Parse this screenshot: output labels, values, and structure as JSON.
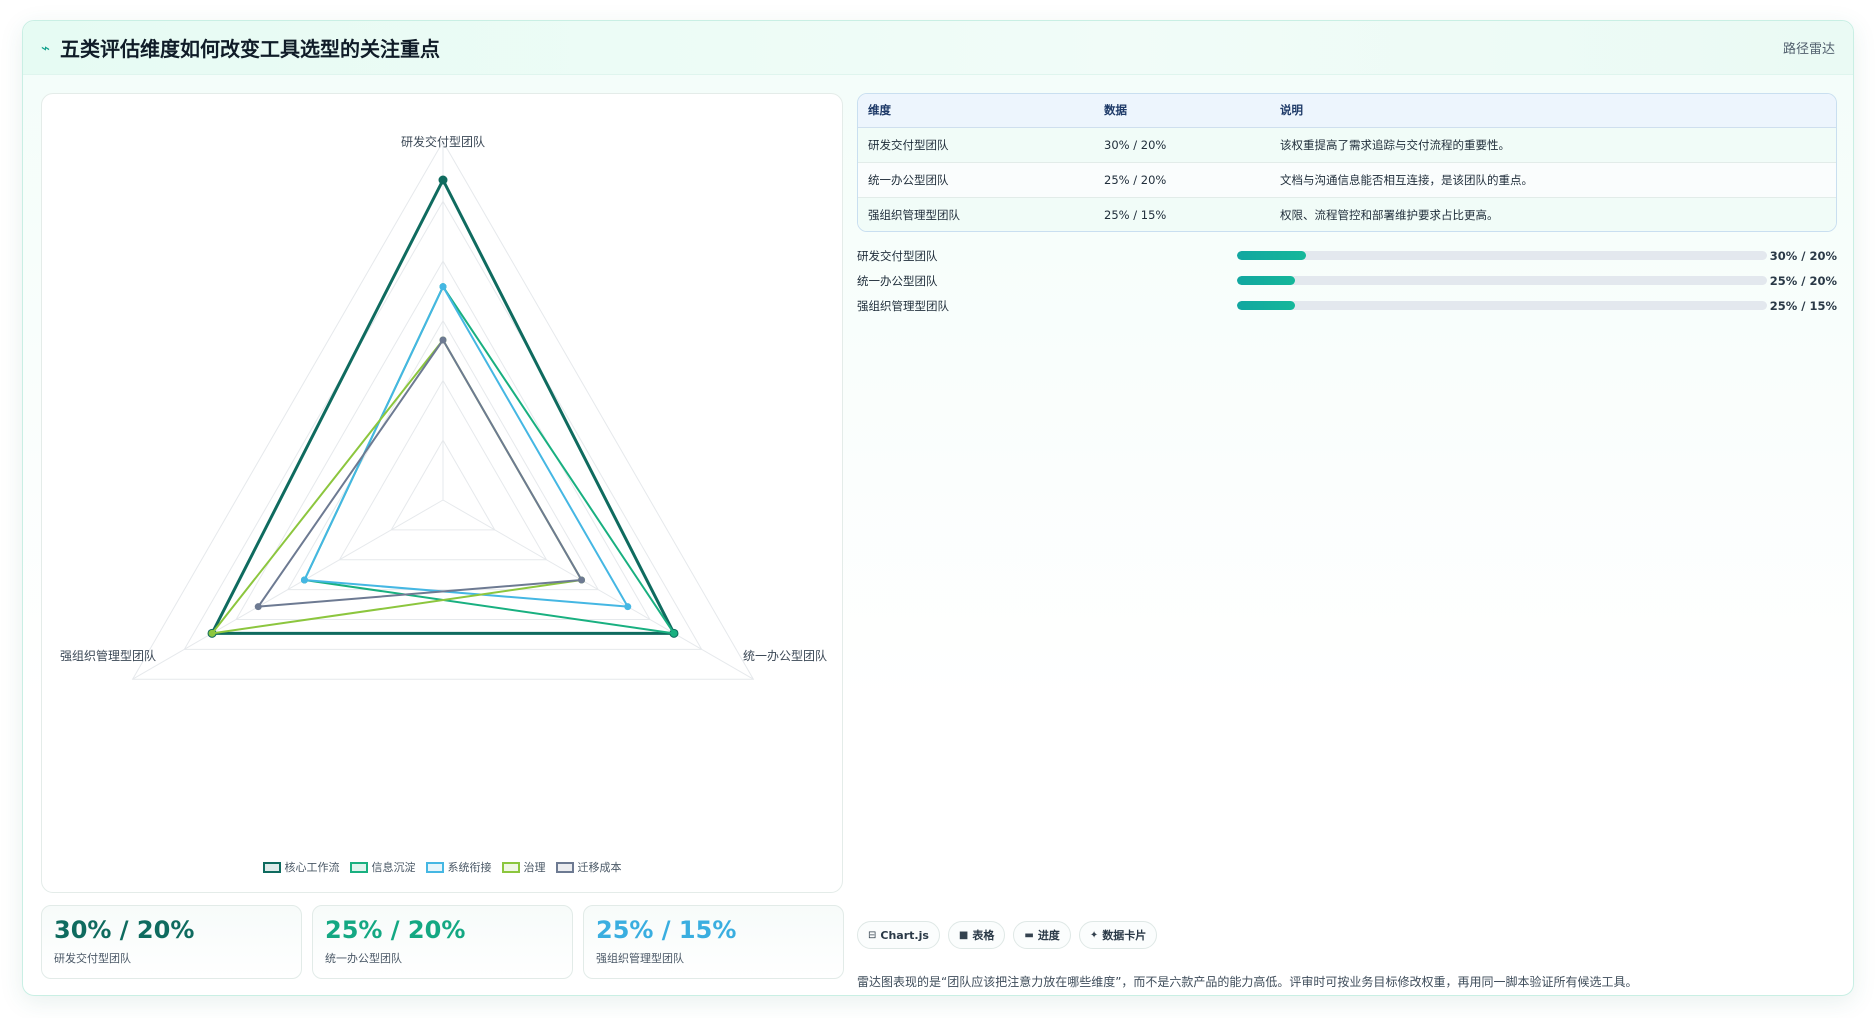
{
  "header": {
    "title": "五类评估维度如何改变工具选型的关注重点",
    "title_icon": "spark-icon",
    "tag": "路径雷达"
  },
  "chart_data": {
    "type": "radar",
    "axes": [
      "研发交付型团队",
      "统一办公型团队",
      "强组织管理型团队"
    ],
    "r_range": [
      0,
      30
    ],
    "grid": true,
    "legend_position": "bottom",
    "series": [
      {
        "name": "核心工作流",
        "color": "#0f6b5f",
        "values": [
          30,
          25,
          25
        ]
      },
      {
        "name": "信息沉淀",
        "color": "#19b080",
        "values": [
          20,
          25,
          15
        ]
      },
      {
        "name": "系统衔接",
        "color": "#45b7e3",
        "values": [
          20,
          20,
          15
        ]
      },
      {
        "name": "治理",
        "color": "#8cc63e",
        "values": [
          15,
          15,
          25
        ]
      },
      {
        "name": "迁移成本",
        "color": "#6d7a92",
        "values": [
          15,
          15,
          20
        ]
      }
    ]
  },
  "table": {
    "headers": [
      "维度",
      "数据",
      "说明"
    ],
    "rows": [
      [
        "研发交付型团队",
        "30% / 20%",
        "该权重提高了需求追踪与交付流程的重要性。"
      ],
      [
        "统一办公型团队",
        "25% / 20%",
        "文档与沟通信息能否相互连接，是该团队的重点。"
      ],
      [
        "强组织管理型团队",
        "25% / 15%",
        "权限、流程管控和部署维护要求占比更高。"
      ]
    ]
  },
  "progress": [
    {
      "name": "研发交付型团队",
      "value_text": "30% / 20%",
      "fill": 0.13
    },
    {
      "name": "统一办公型团队",
      "value_text": "25% / 20%",
      "fill": 0.11
    },
    {
      "name": "强组织管理型团队",
      "value_text": "25% / 15%",
      "fill": 0.11
    }
  ],
  "cards": [
    {
      "value": "30% / 20%",
      "label": "研发交付型团队",
      "color": "#0f6b5f"
    },
    {
      "value": "25% / 20%",
      "label": "统一办公型团队",
      "color": "#14a883"
    },
    {
      "value": "25% / 15%",
      "label": "强组织管理型团队",
      "color": "#3aaee0"
    }
  ],
  "chips": [
    {
      "icon": "chart-icon",
      "glyph": "⊟",
      "label": "Chart.js"
    },
    {
      "icon": "table-icon",
      "glyph": "■",
      "label": "表格"
    },
    {
      "icon": "progress-icon",
      "glyph": "▬",
      "label": "进度"
    },
    {
      "icon": "card-icon",
      "glyph": "✦",
      "label": "数据卡片"
    }
  ],
  "note": "雷达图表现的是“团队应该把注意力放在哪些维度”，而不是六款产品的能力高低。评审时可按业务目标修改权重，再用同一脚本验证所有候选工具。"
}
